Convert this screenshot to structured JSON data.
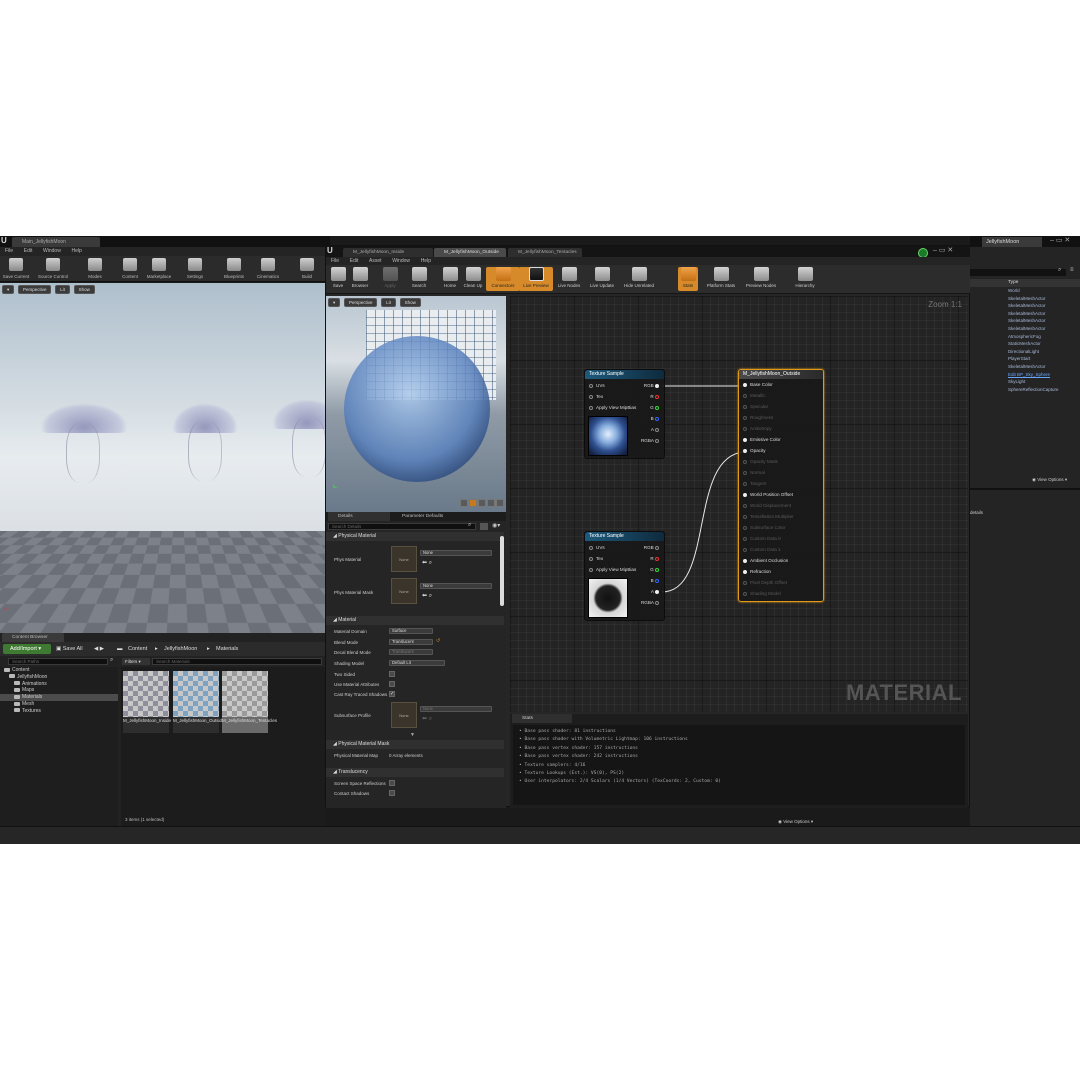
{
  "main_editor": {
    "tab_title": "Main_JellyfishMoon",
    "menu": [
      "File",
      "Edit",
      "Window",
      "Help"
    ],
    "toolbar": [
      "Save Current",
      "Source Control",
      "Modes",
      "Content",
      "Marketplace",
      "Settings",
      "Blueprints",
      "Cinematics",
      "Build"
    ],
    "viewport": {
      "perspective": "Perspective",
      "lit": "Lit",
      "show": "Show"
    }
  },
  "content_browser": {
    "tab": "Content Browser",
    "add_import": "Add/Import",
    "save_all": "Save All",
    "breadcrumb": [
      "Content",
      "JellyfishMoon",
      "Materials"
    ],
    "search_paths_placeholder": "Search Paths",
    "filters": "Filters",
    "search_materials_placeholder": "Search Materials",
    "tree": [
      "Content",
      "JellyfishMoon",
      "Animations",
      "Maps",
      "Materials",
      "Mesh",
      "Textures"
    ],
    "assets": [
      {
        "name": "M_JellyfishMoon_Inside"
      },
      {
        "name": "M_JellyfishMoon_Outside"
      },
      {
        "name": "M_JellyfishMoon_Tentacles"
      }
    ],
    "status": "3 items (1 selected)",
    "view_options": "View Options"
  },
  "material_editor": {
    "tabs": [
      "M_JellyfishMoon_Inside",
      "M_JellyfishMoon_Outside",
      "M_JellyfishMoon_Tentacles"
    ],
    "menu": [
      "File",
      "Edit",
      "Asset",
      "Window",
      "Help"
    ],
    "toolbar": [
      "Save",
      "Browser",
      "Apply",
      "Search",
      "Home",
      "Clean Up",
      "Connectors",
      "Live Preview",
      "Live Nodes",
      "Live Update",
      "Hide Unrelated",
      "Stats",
      "Platform Stats",
      "Preview Nodes",
      "Hierarchy"
    ],
    "preview": {
      "perspective": "Perspective",
      "lit": "Lit",
      "show": "Show"
    },
    "details": {
      "tab_details": "Details",
      "tab_params": "Parameter Defaults",
      "search_placeholder": "Search Details",
      "physical_material": "Physical Material",
      "phys_material": "Phys Material",
      "phys_material_mask": "Phys Material Mask",
      "none": "None",
      "material": "Material",
      "material_domain": "Material Domain",
      "material_domain_val": "Surface",
      "blend_mode": "Blend Mode",
      "blend_mode_val": "Translucent",
      "decal_blend_mode": "Decal Blend Mode",
      "decal_blend_mode_val": "Translucent",
      "shading_model": "Shading Model",
      "shading_model_val": "Default Lit",
      "two_sided": "Two Sided",
      "use_material_attributes": "Use Material Attributes",
      "cast_ray_traced_shadows": "Cast Ray Traced Shadows",
      "subsurface_profile": "Subsurface Profile",
      "physical_material_mask": "Physical Material Mask",
      "physical_material_map": "Physical Material Map",
      "array_elements": "0 Array elements",
      "translucency": "Translucency",
      "screen_space_reflections": "Screen Space Reflections",
      "contact_shadows": "Contact Shadows"
    },
    "graph": {
      "zoom": "Zoom 1:1",
      "watermark": "MATERIAL",
      "texture_node_title": "Texture Sample",
      "texture_inputs": [
        "UVs",
        "Tex",
        "Apply View MipBias"
      ],
      "texture_outputs": [
        "RGB",
        "R",
        "G",
        "B",
        "A",
        "RGBA"
      ],
      "result_node_title": "M_JellyfishMoon_Outside",
      "result_pins": [
        {
          "label": "Base Color",
          "active": true
        },
        {
          "label": "Metallic",
          "active": false
        },
        {
          "label": "Specular",
          "active": false
        },
        {
          "label": "Roughness",
          "active": false
        },
        {
          "label": "Anisotropy",
          "active": false
        },
        {
          "label": "Emissive Color",
          "active": true
        },
        {
          "label": "Opacity",
          "active": true
        },
        {
          "label": "Opacity Mask",
          "active": false
        },
        {
          "label": "Normal",
          "active": false
        },
        {
          "label": "Tangent",
          "active": false
        },
        {
          "label": "World Position Offset",
          "active": true
        },
        {
          "label": "World Displacement",
          "active": false
        },
        {
          "label": "Tessellation Multiplier",
          "active": false
        },
        {
          "label": "Subsurface Color",
          "active": false
        },
        {
          "label": "Custom Data 0",
          "active": false
        },
        {
          "label": "Custom Data 1",
          "active": false
        },
        {
          "label": "Ambient Occlusion",
          "active": true
        },
        {
          "label": "Refraction",
          "active": true
        },
        {
          "label": "Pixel Depth Offset",
          "active": false
        },
        {
          "label": "Shading Model",
          "active": false
        }
      ]
    },
    "stats": {
      "tab": "Stats",
      "lines": [
        "• Base pass shader: 81 instructions",
        "• Base pass shader with Volumetric Lightmap: 106 instructions",
        "• Base pass vertex shader: 157 instructions",
        "• Base pass vertex shader: 242 instructions",
        "• Texture samplers: 4/16",
        "• Texture Lookups (Est.): VS(0), PS(2)",
        "• User interpolators: 2/4 Scalars (1/4 Vectors) (TexCoords: 2, Custom: 0)"
      ]
    }
  },
  "outliner": {
    "tab": "JellyfishMoon",
    "type_header": "Type",
    "types": [
      "World",
      "SkeletalMeshActor",
      "SkeletalMeshActor",
      "SkeletalMeshActor",
      "SkeletalMeshActor",
      "SkeletalMeshActor",
      "AtmosphericFog",
      "StaticMeshActor",
      "DirectionalLight",
      "PlayerStart",
      "SkeletalMeshActor",
      "Edit BP_Sky_Sphere",
      "SkyLight",
      "SphereReflectionCapture"
    ],
    "view_options": "View Options",
    "details": "details"
  },
  "colors": {
    "accent": "#d78a2a",
    "result_node_border": "#e09a1a",
    "texture_node_header": "#1d5a7d",
    "add_button": "#3e7a32"
  }
}
